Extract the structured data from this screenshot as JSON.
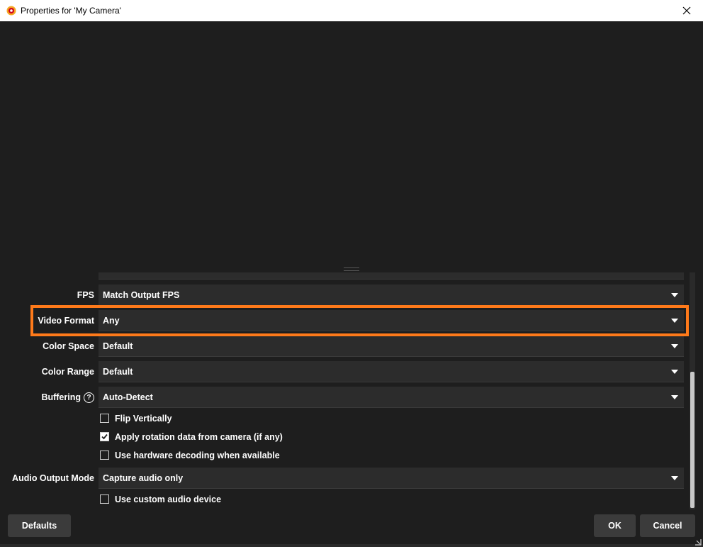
{
  "window": {
    "title": "Properties for 'My Camera'"
  },
  "properties": {
    "fps": {
      "label": "FPS",
      "value": "Match Output FPS"
    },
    "video_format": {
      "label": "Video Format",
      "value": "Any"
    },
    "color_space": {
      "label": "Color Space",
      "value": "Default"
    },
    "color_range": {
      "label": "Color Range",
      "value": "Default"
    },
    "buffering": {
      "label": "Buffering",
      "value": "Auto-Detect"
    },
    "flip_vertically": {
      "label": "Flip Vertically",
      "checked": false
    },
    "apply_rotation": {
      "label": "Apply rotation data from camera (if any)",
      "checked": true
    },
    "hw_decoding": {
      "label": "Use hardware decoding when available",
      "checked": false
    },
    "audio_output_mode": {
      "label": "Audio Output Mode",
      "value": "Capture audio only"
    },
    "custom_audio": {
      "label": "Use custom audio device",
      "checked": false
    }
  },
  "buttons": {
    "defaults": "Defaults",
    "ok": "OK",
    "cancel": "Cancel"
  },
  "icons": {
    "app": "obs-app-icon",
    "close": "close-icon",
    "dropdown": "chevron-down-icon",
    "help": "help-icon",
    "check": "checkmark-icon"
  },
  "colors": {
    "highlight": "#ff7a1a",
    "background": "#1e1e1e",
    "combo": "#2c2c2c"
  },
  "help_glyph": "?"
}
